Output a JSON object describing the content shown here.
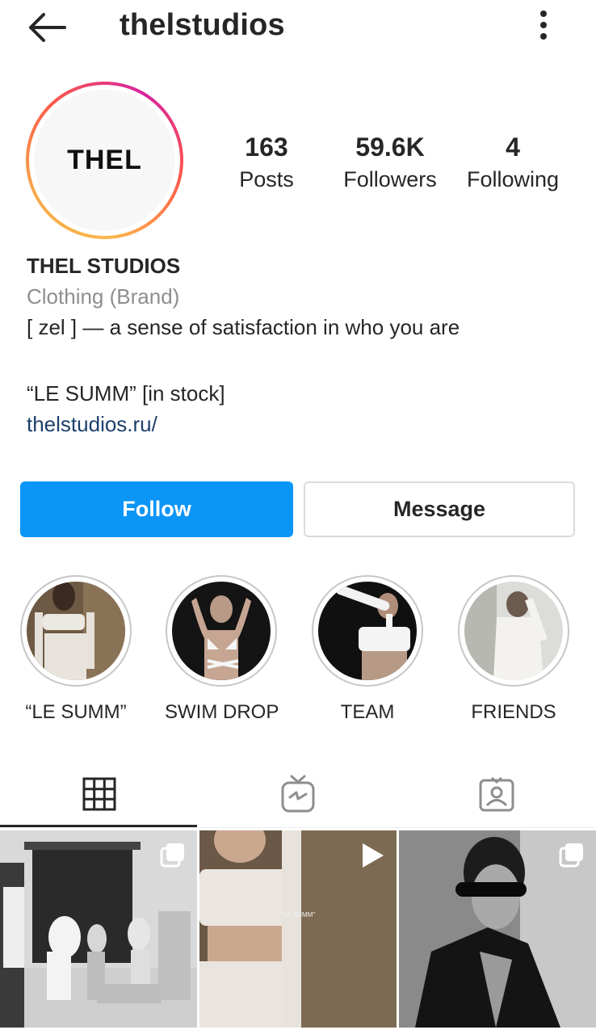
{
  "header": {
    "username": "thelstudios",
    "back_icon": "arrow-left-icon",
    "more_icon": "more-vertical-icon"
  },
  "profile": {
    "avatar_text": "THEL",
    "stats": [
      {
        "value": "163",
        "label": "Posts"
      },
      {
        "value": "59.6K",
        "label": "Followers"
      },
      {
        "value": "4",
        "label": "Following"
      }
    ],
    "name": "THEL STUDIOS",
    "category": "Clothing (Brand)",
    "bio_lines": [
      "[ zel ] — a sense of satisfaction in who you are",
      "“LE SUMM” [in stock]"
    ],
    "link": "thelstudios.ru/"
  },
  "actions": {
    "follow_label": "Follow",
    "message_label": "Message"
  },
  "highlights": [
    {
      "label": "“LE SUMM”"
    },
    {
      "label": "SWIM DROP"
    },
    {
      "label": "TEAM"
    },
    {
      "label": "FRIENDS"
    }
  ],
  "tabs": [
    {
      "icon": "grid-icon",
      "active": true
    },
    {
      "icon": "igtv-icon",
      "active": false
    },
    {
      "icon": "tagged-icon",
      "active": false
    }
  ],
  "grid": [
    {
      "badge": "carousel-icon"
    },
    {
      "badge": "play-icon",
      "overlay_text": "\"LE SUMM\""
    },
    {
      "badge": "carousel-icon"
    }
  ],
  "colors": {
    "follow_blue": "#0b95f6",
    "link_color": "#1d3f6b",
    "muted_text": "#8e8e8e"
  }
}
